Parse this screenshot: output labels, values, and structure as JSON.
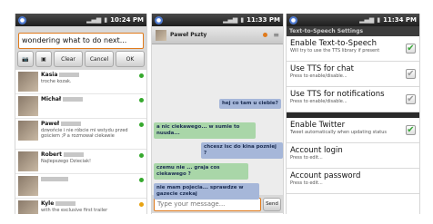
{
  "screens": [
    {
      "status_time": "10:24 PM",
      "message_input": "wondering what to do next...",
      "buttons": {
        "clear": "Clear",
        "cancel": "Cancel",
        "ok": "OK"
      },
      "contacts": [
        {
          "name": "Kasia",
          "status": "troche kozak.",
          "presence": "online"
        },
        {
          "name": "Michał",
          "status": "",
          "presence": "online"
        },
        {
          "name": "Paweł",
          "status": "dzwońcie i nie róbcie mi wstydu przed gościem ;P a rozmował ciekawie",
          "presence": "online"
        },
        {
          "name": "Robert",
          "status": "Najlepszego Dzieciak!",
          "presence": "online"
        },
        {
          "name": "",
          "status": "",
          "presence": "online"
        },
        {
          "name": "Kyle",
          "status": "with the exclusive first trailer",
          "presence": "away"
        }
      ]
    },
    {
      "status_time": "11:33 PM",
      "chat_partner": "Paweł Pszty",
      "messages": [
        {
          "from": "me",
          "text": "hej co tam u ciebie?"
        },
        {
          "from": "them",
          "text": "a nic ciekawego... w sumie to nuuda..."
        },
        {
          "from": "me",
          "text": "chcesz isc do kina pozniej ?"
        },
        {
          "from": "them",
          "text": "czemu nie ... graja cos ciekawego ?"
        },
        {
          "from": "me",
          "text": "nie mam pojecia... sprawdze w gazecie czekaj"
        }
      ],
      "compose_placeholder": "Type your message...",
      "send_label": "Send"
    },
    {
      "status_time": "11:34 PM",
      "settings_title": "Text-to-Speech Settings",
      "prefs": [
        {
          "title": "Enable Text-to-Speech",
          "summary": "Will try to use the TTS library if present",
          "checked": true
        },
        {
          "title": "Use TTS for chat",
          "summary": "Press to enable/disable...",
          "checked": false
        },
        {
          "title": "Use TTS for notifications",
          "summary": "Press to enable/disable...",
          "checked": false
        },
        {
          "title": "Enable Twitter",
          "summary": "Tweet automatically when updating status",
          "checked": true
        },
        {
          "title": "Account login",
          "summary": "Press to edit..."
        },
        {
          "title": "Account password",
          "summary": "Press to edit..."
        }
      ]
    }
  ],
  "icons": {
    "check": "✔",
    "camera": "📷",
    "image": "▣",
    "menu": "≡",
    "signal": "▂▄▆",
    "battery": "▮"
  }
}
